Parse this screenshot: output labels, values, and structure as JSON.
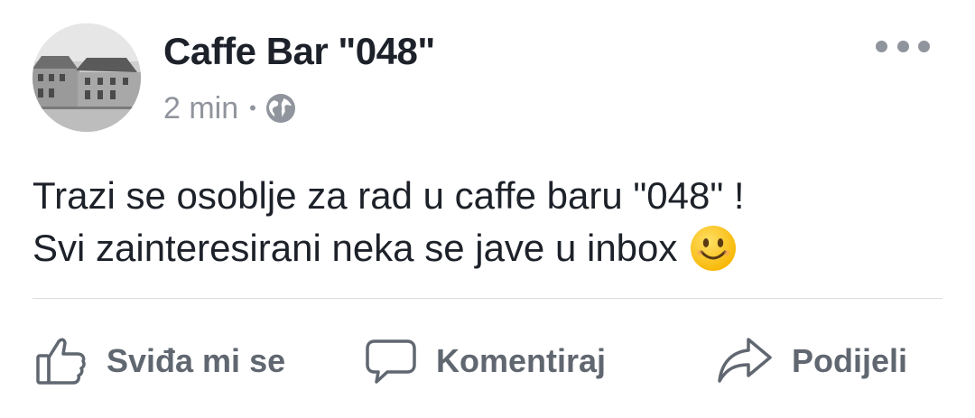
{
  "post": {
    "author": "Caffe Bar \"048\"",
    "time": "2 min",
    "separator": "•",
    "privacy_icon": "globe-icon",
    "more_icon": "more-horizontal-icon",
    "text_lines": [
      "Trazi se osoblje za rad u caffe baru \"048\" !",
      "Svi zainteresirani neka se jave u inbox"
    ],
    "emoji": "smiling-face-emoji"
  },
  "actions": {
    "like": {
      "label": "Sviđa mi se",
      "icon": "thumbs-up-icon"
    },
    "comment": {
      "label": "Komentiraj",
      "icon": "speech-bubble-icon"
    },
    "share": {
      "label": "Podijeli",
      "icon": "share-arrow-icon"
    }
  },
  "colors": {
    "text": "#1d2129",
    "meta": "#90949c",
    "action": "#606770",
    "divider": "#dadde1",
    "emoji": "#ffcc33"
  }
}
